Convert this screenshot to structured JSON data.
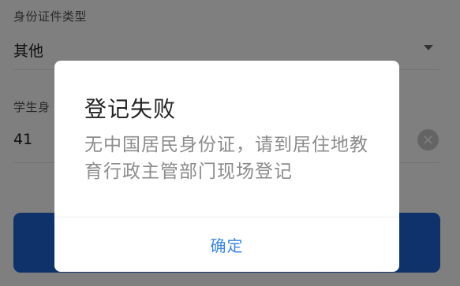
{
  "form": {
    "id_type": {
      "label": "身份证件类型",
      "value": "其他"
    },
    "student_id": {
      "label": "学生身",
      "value": "41",
      "clear_icon": "×"
    }
  },
  "dialog": {
    "title": "登记失败",
    "message": "无中国居民身份证，请到居住地教育行政主管部门现场登记",
    "confirm_label": "确定"
  },
  "colors": {
    "primary": "#1e64d6",
    "confirm_text": "#3a86e8",
    "overlay": "rgba(0,0,0,0.5)"
  }
}
